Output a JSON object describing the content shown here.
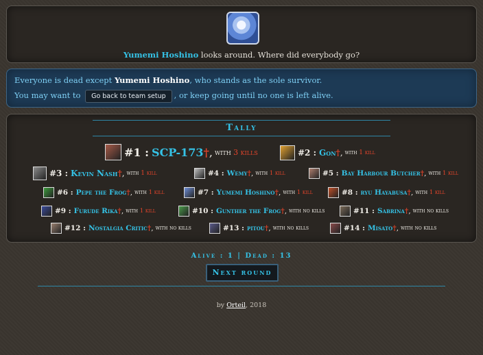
{
  "event": {
    "actor": "Yumemi Hoshino",
    "text": " looks around. Where did everybody go?"
  },
  "info": {
    "line1_pre": "Everyone is dead except ",
    "line1_name": "Yumemi Hoshino",
    "line1_post": ", who stands as the sole survivor.",
    "line2_pre": "You may want to",
    "setup_button": "Go back to team setup",
    "line2_post": ", or keep going until no one is left alive."
  },
  "tally": {
    "title": "Tally",
    "dagger": "†",
    "with": "with",
    "entries": [
      {
        "rank": "#1 :",
        "name": "SCP-173",
        "kills": "3 kills",
        "color": "#a65a48"
      },
      {
        "rank": "#2 :",
        "name": "Gon",
        "kills": "1 kill",
        "color": "#e0a030"
      },
      {
        "rank": "#3 :",
        "name": "Kevin Nash",
        "kills": "1 kill",
        "color": "#8c8c8c"
      },
      {
        "rank": "#4 :",
        "name": "Wemy",
        "kills": "1 kill",
        "color": "#bdbdbd"
      },
      {
        "rank": "#5 :",
        "name": "Bay Harbour Butcher",
        "kills": "1 kill",
        "color": "#b08070"
      },
      {
        "rank": "#6 :",
        "name": "Pepe the Frog",
        "kills": "1 kill",
        "color": "#3d9a3d"
      },
      {
        "rank": "#7 :",
        "name": "Yumemi Hoshino",
        "kills": "1 kill",
        "color": "#6f8fd8"
      },
      {
        "rank": "#8 :",
        "name": "ryu Hayabusa",
        "kills": "1 kill",
        "color": "#c05028"
      },
      {
        "rank": "#9 :",
        "name": "Furude Rika",
        "kills": "1 kill",
        "color": "#3a4a9a"
      },
      {
        "rank": "#10 :",
        "name": "Gunther the Frog",
        "kills": "no kills",
        "color": "#4a9a4a"
      },
      {
        "rank": "#11 :",
        "name": "Sabrina",
        "kills": "no kills",
        "color": "#7a6a58"
      },
      {
        "rank": "#12 :",
        "name": "Nostalgia Critic",
        "kills": "no kills",
        "color": "#9a8070"
      },
      {
        "rank": "#13 :",
        "name": "pitou",
        "kills": "no kills",
        "color": "#5a5a8a"
      },
      {
        "rank": "#14 :",
        "name": "Misato",
        "kills": "no kills",
        "color": "#8a4a4a"
      }
    ]
  },
  "status": "Alive : 1 | Dead : 13",
  "next_button": "Next round",
  "footer": {
    "by": "by ",
    "author": "Orteil",
    "year": ", 2018"
  }
}
